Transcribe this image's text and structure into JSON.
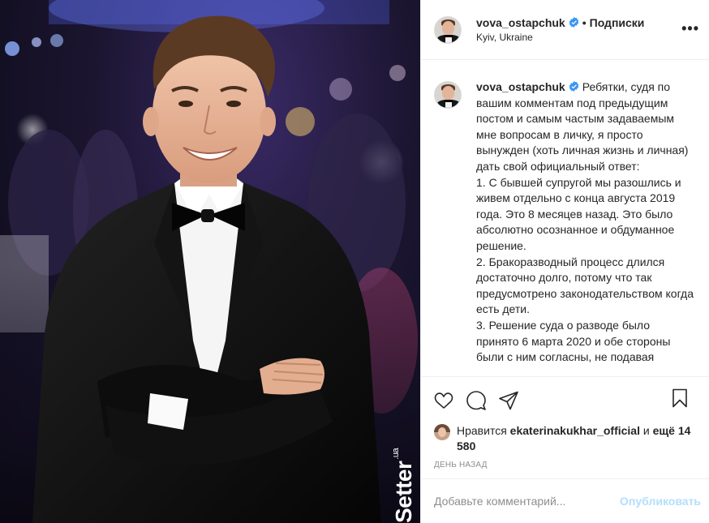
{
  "post": {
    "image_alt": "Фото",
    "watermark": {
      "brand": "Setter",
      "suffix": ".ua"
    }
  },
  "header": {
    "username": "vova_ostapchuk",
    "verified": true,
    "separator": "•",
    "follow_label": "Подписки",
    "location": "Kyiv, Ukraine",
    "more_icon": "more-horizontal-icon"
  },
  "caption": {
    "username": "vova_ostapchuk",
    "text": "Ребятки, судя по вашим комментам под предыдущим постом и самым частым задаваемым мне вопросам в личку, я просто вынужден (хоть личная жизнь и личная) дать свой официальный ответ:\n1. С бывшей супругой мы разошлись и живем отдельно с конца августа 2019 года. Это 8 месяцев назад. Это было абсолютно осознанное и обдуманное решение.\n2. Бракоразводный процесс длился достаточно долго, потому что так предусмотрено законодательством когда есть дети.\n3. Решение суда о разводе было принято 6 марта 2020 и обе стороны были с ним согласны, не подавая"
  },
  "actions": {
    "like_icon": "heart-icon",
    "comment_icon": "comment-icon",
    "share_icon": "share-icon",
    "save_icon": "bookmark-icon"
  },
  "likes": {
    "prefix": "Нравится",
    "user": "ekaterinakukhar_official",
    "conjunction": "и",
    "others": "ещё 14 580"
  },
  "timestamp": "День назад",
  "comment_box": {
    "placeholder": "Добавьте комментарий...",
    "publish_label": "Опубликовать"
  },
  "colors": {
    "verified": "#3897f0",
    "publish_disabled": "#b2dffc",
    "muted": "#8e8e8e",
    "text": "#262626"
  }
}
